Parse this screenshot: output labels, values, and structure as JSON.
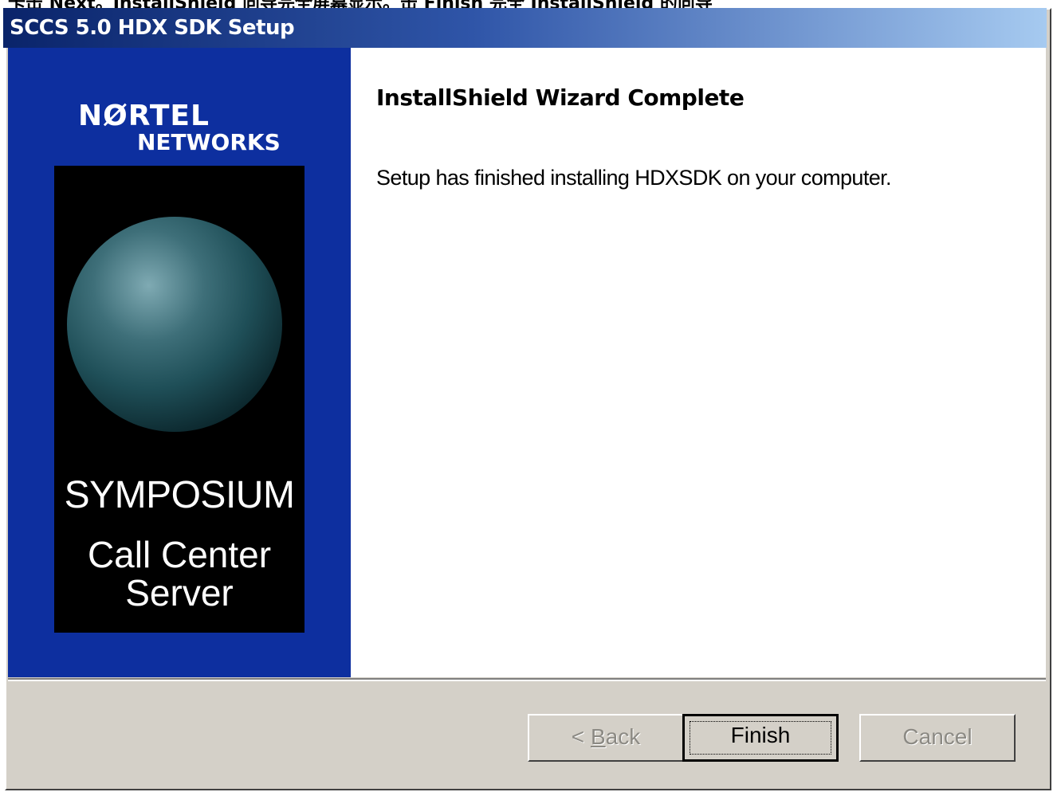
{
  "caption_fragment": "卡击 Next。InstallShield 向导完全屏幕显示。击 Finish 完全 InstallShield 的向导",
  "window": {
    "title": "SCCS 5.0 HDX SDK Setup"
  },
  "branding": {
    "logo_line1": "NØRTEL",
    "logo_line2": "NETWORKS",
    "product_line1": "SYMPOSIUM",
    "product_line2": "Call Center",
    "product_line3": "Server"
  },
  "content": {
    "heading": "InstallShield Wizard Complete",
    "message": "Setup has finished installing HDXSDK on your computer."
  },
  "buttons": {
    "back_prefix": "< ",
    "back_mnemonic": "B",
    "back_rest": "ack",
    "finish": "Finish",
    "cancel": "Cancel"
  }
}
